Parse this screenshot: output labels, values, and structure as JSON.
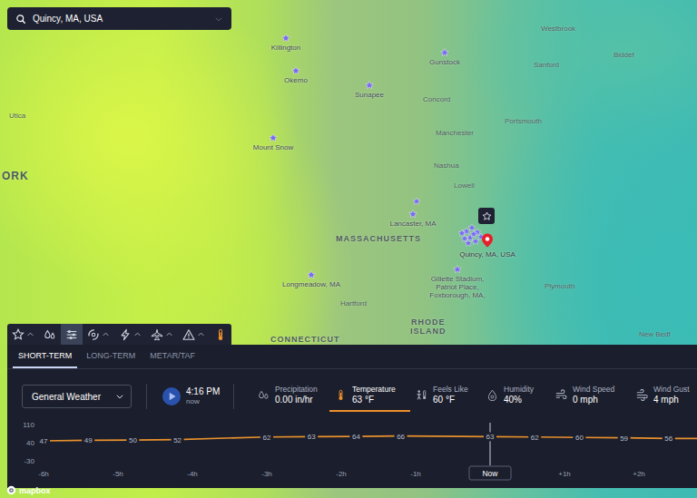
{
  "search": {
    "value": "Quincy, MA, USA"
  },
  "map": {
    "base_labels": [
      {
        "lines": [
          "Westbrook"
        ],
        "kind": "city"
      },
      {
        "lines": [
          "Sanford"
        ],
        "kind": "city"
      },
      {
        "lines": [
          "Biddef"
        ],
        "kind": "city"
      },
      {
        "lines": [
          "Concord"
        ],
        "kind": "city"
      },
      {
        "lines": [
          "Portsmouth"
        ],
        "kind": "city"
      },
      {
        "lines": [
          "Manchester"
        ],
        "kind": "city"
      },
      {
        "lines": [
          "Nashua"
        ],
        "kind": "city"
      },
      {
        "lines": [
          "Lowell"
        ],
        "kind": "city"
      },
      {
        "lines": [
          "Utica"
        ],
        "kind": "city"
      },
      {
        "lines": [
          "ORK"
        ],
        "kind": "region"
      },
      {
        "lines": [
          "MASSACHUSETTS"
        ],
        "kind": "state"
      },
      {
        "lines": [
          "Hartford"
        ],
        "kind": "city"
      },
      {
        "lines": [
          "RHODE",
          "ISLAND"
        ],
        "kind": "state"
      },
      {
        "lines": [
          "CONNECTICUT"
        ],
        "kind": "state"
      },
      {
        "lines": [
          "Plymouth"
        ],
        "kind": "city"
      },
      {
        "lines": [
          "New Bedf"
        ],
        "kind": "city"
      }
    ],
    "favorites": [
      {
        "lines": [
          "Killington"
        ]
      },
      {
        "lines": [
          "Okemo"
        ]
      },
      {
        "lines": [
          "Sunapee"
        ]
      },
      {
        "lines": [
          "Gunstock"
        ]
      },
      {
        "lines": [
          "Mount Snow"
        ]
      },
      {
        "lines": [
          "Lancaster, MA"
        ]
      },
      {
        "lines": [
          "Longmeadow, MA"
        ]
      },
      {
        "lines": [
          "Gillette Stadium,",
          "Patriot Place,",
          "Foxborough, MA,"
        ]
      }
    ],
    "pin": {
      "label": "Quincy, MA, USA"
    }
  },
  "toolbar": {
    "tools": [
      {
        "kind": "favorites",
        "menu": true,
        "selected": false,
        "active": false
      },
      {
        "kind": "precipitation",
        "menu": false,
        "selected": false,
        "active": false
      },
      {
        "kind": "layers",
        "menu": false,
        "selected": true,
        "active": false
      },
      {
        "kind": "tropical",
        "menu": true,
        "selected": false,
        "active": false
      },
      {
        "kind": "lightning",
        "menu": true,
        "selected": false,
        "active": false
      },
      {
        "kind": "aviation",
        "menu": true,
        "selected": false,
        "active": false
      },
      {
        "kind": "alerts",
        "menu": true,
        "selected": false,
        "active": false
      },
      {
        "kind": "temperature",
        "menu": false,
        "selected": false,
        "active": true
      }
    ]
  },
  "panel": {
    "tabs": [
      {
        "label": "SHORT-TERM",
        "selected": true
      },
      {
        "label": "LONG-TERM",
        "selected": false
      },
      {
        "label": "METAR/TAF",
        "selected": false
      }
    ],
    "layer_select": {
      "value": "General Weather"
    },
    "time": {
      "value": "4:16 PM",
      "caption": "now",
      "playing": false
    },
    "metrics": [
      {
        "kind": "precipitation",
        "label": "Precipitation",
        "value": "0.00 in/hr",
        "selected": false
      },
      {
        "kind": "temperature",
        "label": "Temperature",
        "value": "63 °F",
        "selected": true
      },
      {
        "kind": "feels",
        "label": "Feels Like",
        "value": "60 °F",
        "selected": false
      },
      {
        "kind": "humidity",
        "label": "Humidity",
        "value": "40%",
        "selected": false
      },
      {
        "kind": "wind",
        "label": "Wind Speed",
        "value": "0 mph",
        "selected": false
      },
      {
        "kind": "gust",
        "label": "Wind Gust",
        "value": "4 mph",
        "selected": false
      }
    ],
    "chart": {
      "y_ticks": [
        "110",
        "40",
        "-30"
      ],
      "y_max": 110,
      "y_min": -30,
      "x_ticks": [
        {
          "label": "-6h",
          "hour": -6
        },
        {
          "label": "-5h",
          "hour": -5
        },
        {
          "label": "-4h",
          "hour": -4
        },
        {
          "label": "-3h",
          "hour": -3
        },
        {
          "label": "-2h",
          "hour": -2
        },
        {
          "label": "-1h",
          "hour": -1
        },
        {
          "label": "+1h",
          "hour": 1
        },
        {
          "label": "+2h",
          "hour": 2
        }
      ],
      "now": {
        "label": "Now",
        "hour": 0
      },
      "series": [
        {
          "hours": [
            -6,
            -5.4,
            -4.8,
            -4.2,
            -3,
            -2.4,
            -1.8,
            -1.2,
            0,
            0.6,
            1.2,
            1.8,
            2.4
          ],
          "values": [
            47,
            49,
            50,
            52,
            62,
            63,
            64,
            66,
            63,
            62,
            60,
            59,
            56
          ],
          "labels": [
            "47",
            "49",
            "50",
            "52",
            "62",
            "63",
            "64",
            "66",
            "63",
            "62",
            "60",
            "59",
            "56"
          ]
        }
      ]
    }
  },
  "logo": {
    "text": "mapbox"
  }
}
